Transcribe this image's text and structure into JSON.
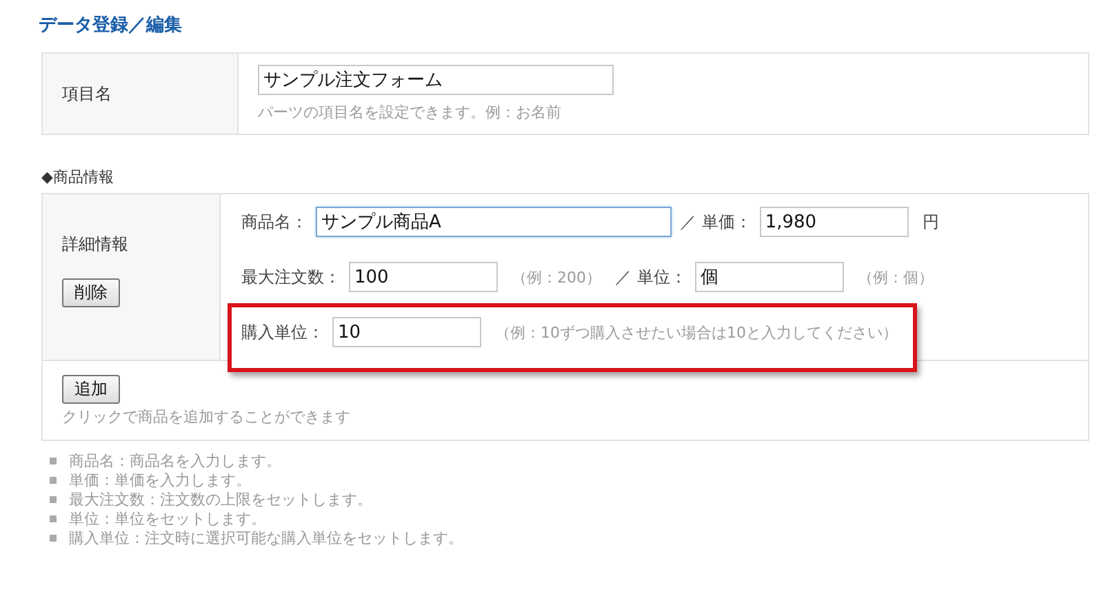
{
  "title": "データ登録／編集",
  "item_name": {
    "label": "項目名",
    "value": "サンプル注文フォーム",
    "hint": "パーツの項目名を設定できます。例：お名前"
  },
  "section_label": "◆商品情報",
  "details": {
    "label": "詳細情報",
    "delete_button": "削除",
    "rows": [
      {
        "highlighted": false,
        "parts": [
          {
            "kind": "label",
            "text": "商品名："
          },
          {
            "kind": "wide_field",
            "value": "サンプル商品A",
            "focused": true
          },
          {
            "kind": "label",
            "text": "／ 単価："
          },
          {
            "kind": "field",
            "value": "1,980",
            "focused": false
          },
          {
            "kind": "unit",
            "text": "円"
          }
        ]
      },
      {
        "highlighted": false,
        "parts": [
          {
            "kind": "label",
            "text": "最大注文数："
          },
          {
            "kind": "field",
            "value": "100",
            "focused": false
          },
          {
            "kind": "hint",
            "text": "（例：200）"
          },
          {
            "kind": "label",
            "text": "／ 単位："
          },
          {
            "kind": "field",
            "value": "個",
            "focused": false
          },
          {
            "kind": "hint",
            "text": "（例：個）"
          }
        ]
      },
      {
        "highlighted": true,
        "parts": [
          {
            "kind": "label",
            "text": "購入単位："
          },
          {
            "kind": "field",
            "value": "10",
            "focused": false
          },
          {
            "kind": "hint",
            "text": "（例：10ずつ購入させたい場合は10と入力してください）"
          }
        ]
      }
    ]
  },
  "add": {
    "button": "追加",
    "hint": "クリックで商品を追加することができます"
  },
  "notes": [
    "商品名：商品名を入力します。",
    "単価：単価を入力します。",
    "最大注文数：注文数の上限をセットします。",
    "単位：単位をセットします。",
    "購入単位：注文時に選択可能な購入単位をセットします。"
  ]
}
